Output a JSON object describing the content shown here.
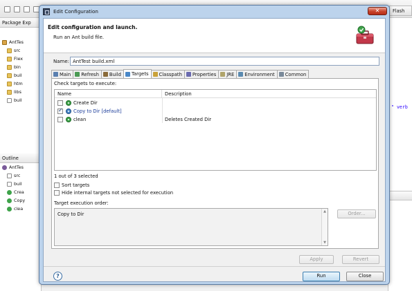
{
  "ide": {
    "package_explorer_tab": "Package Exp",
    "flash_tab": "Flash",
    "outline_tab": "Outline",
    "code_fragment": "\" verb",
    "package_tree": [
      {
        "label": "AntTes",
        "icon": "project"
      },
      {
        "label": "src",
        "icon": "folder"
      },
      {
        "label": "Flex",
        "icon": "folder"
      },
      {
        "label": "bin",
        "icon": "folder"
      },
      {
        "label": "buil",
        "icon": "folder"
      },
      {
        "label": "htm",
        "icon": "folder"
      },
      {
        "label": "libs",
        "icon": "folder"
      },
      {
        "label": "buil",
        "icon": "file"
      }
    ],
    "outline_tree": [
      {
        "label": "AntTes",
        "icon": "ant"
      },
      {
        "label": "src",
        "icon": "property"
      },
      {
        "label": "buil",
        "icon": "property"
      },
      {
        "label": "Crea",
        "icon": "target"
      },
      {
        "label": "Copy",
        "icon": "target"
      },
      {
        "label": "clea",
        "icon": "target"
      }
    ]
  },
  "dialog": {
    "title": "Edit Configuration",
    "close_glyph": "✕",
    "header_title": "Edit configuration and launch.",
    "header_subtitle": "Run an Ant build file.",
    "name_label": "Name:",
    "name_value": "AntTest build.xml",
    "tabs": [
      {
        "label": "Main",
        "icon": "main-icon"
      },
      {
        "label": "Refresh",
        "icon": "refresh-icon"
      },
      {
        "label": "Build",
        "icon": "build-icon"
      },
      {
        "label": "Targets",
        "icon": "targets-icon",
        "active": true
      },
      {
        "label": "Classpath",
        "icon": "classpath-icon"
      },
      {
        "label": "Properties",
        "icon": "properties-icon"
      },
      {
        "label": "JRE",
        "icon": "jre-icon"
      },
      {
        "label": "Environment",
        "icon": "environment-icon"
      },
      {
        "label": "Common",
        "icon": "common-icon"
      }
    ],
    "check_label": "Check targets to execute:",
    "columns": {
      "name": "Name",
      "description": "Description"
    },
    "targets": [
      {
        "name": "Create Dir",
        "description": "",
        "checked": false,
        "is_default": false
      },
      {
        "name": "Copy to Dir [default]",
        "description": "",
        "checked": true,
        "is_default": true
      },
      {
        "name": "clean",
        "description": "Deletes Created Dir",
        "checked": false,
        "is_default": false
      }
    ],
    "selection_count": "1 out of 3 selected",
    "sort_targets_label": "Sort targets",
    "hide_internal_label": "Hide internal targets not selected for execution",
    "order_label": "Target execution order:",
    "order_items": [
      "Copy to Dir"
    ],
    "order_button": "Order...",
    "apply_button": "Apply",
    "revert_button": "Revert",
    "help_glyph": "?",
    "run_button": "Run",
    "close_button": "Close"
  },
  "colors": {
    "dialog_frame": "#bcd3ec",
    "default_target_text": "#1b3c9a",
    "close_button_red": "#c8432b"
  }
}
